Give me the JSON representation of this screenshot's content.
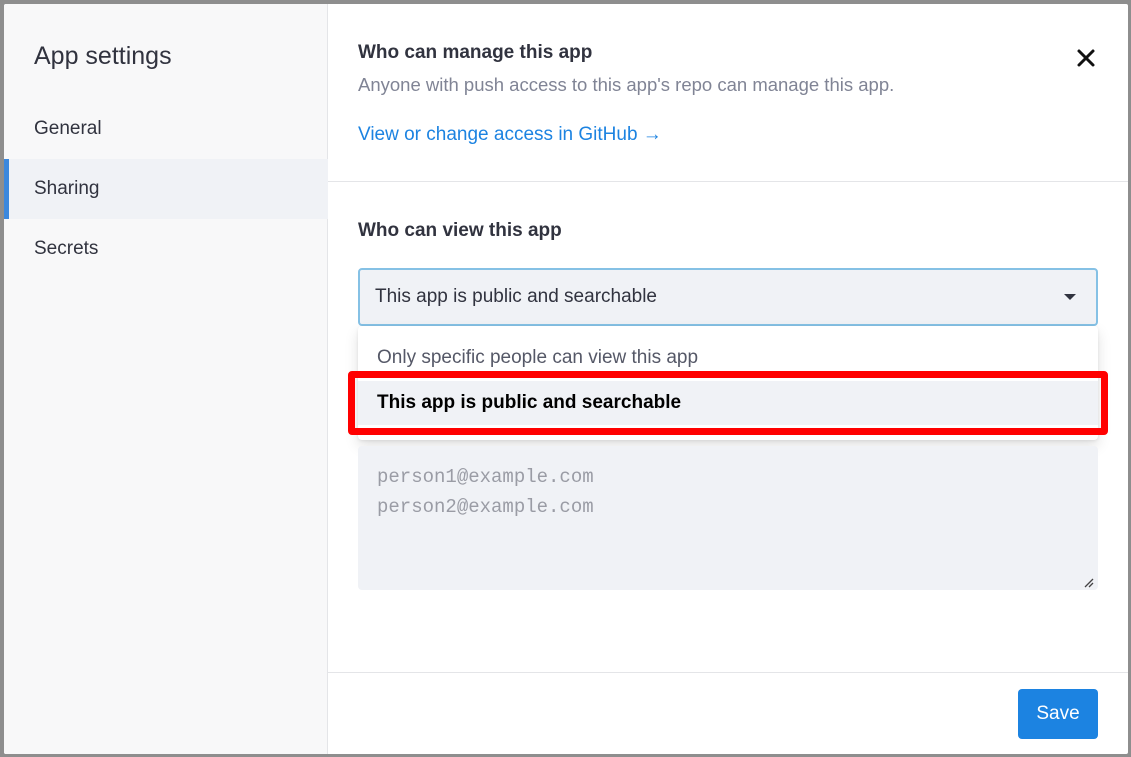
{
  "sidebar": {
    "title": "App settings",
    "items": [
      {
        "label": "General"
      },
      {
        "label": "Sharing"
      },
      {
        "label": "Secrets"
      }
    ]
  },
  "manage": {
    "title": "Who can manage this app",
    "description": "Anyone with push access to this app's repo can manage this app.",
    "link": "View or change access in GitHub →"
  },
  "view": {
    "title": "Who can view this app",
    "selected": "This app is public and searchable",
    "options": [
      "Only specific people can view this app",
      "This app is public and searchable"
    ]
  },
  "emails": {
    "placeholder": "person1@example.com\nperson2@example.com"
  },
  "footer": {
    "save_label": "Save"
  },
  "colors": {
    "accent": "#1c83e1",
    "highlight": "#ff0000"
  },
  "icons": [
    "close-icon",
    "chevron-down-icon",
    "arrow-right-icon",
    "resize-grip-icon"
  ]
}
